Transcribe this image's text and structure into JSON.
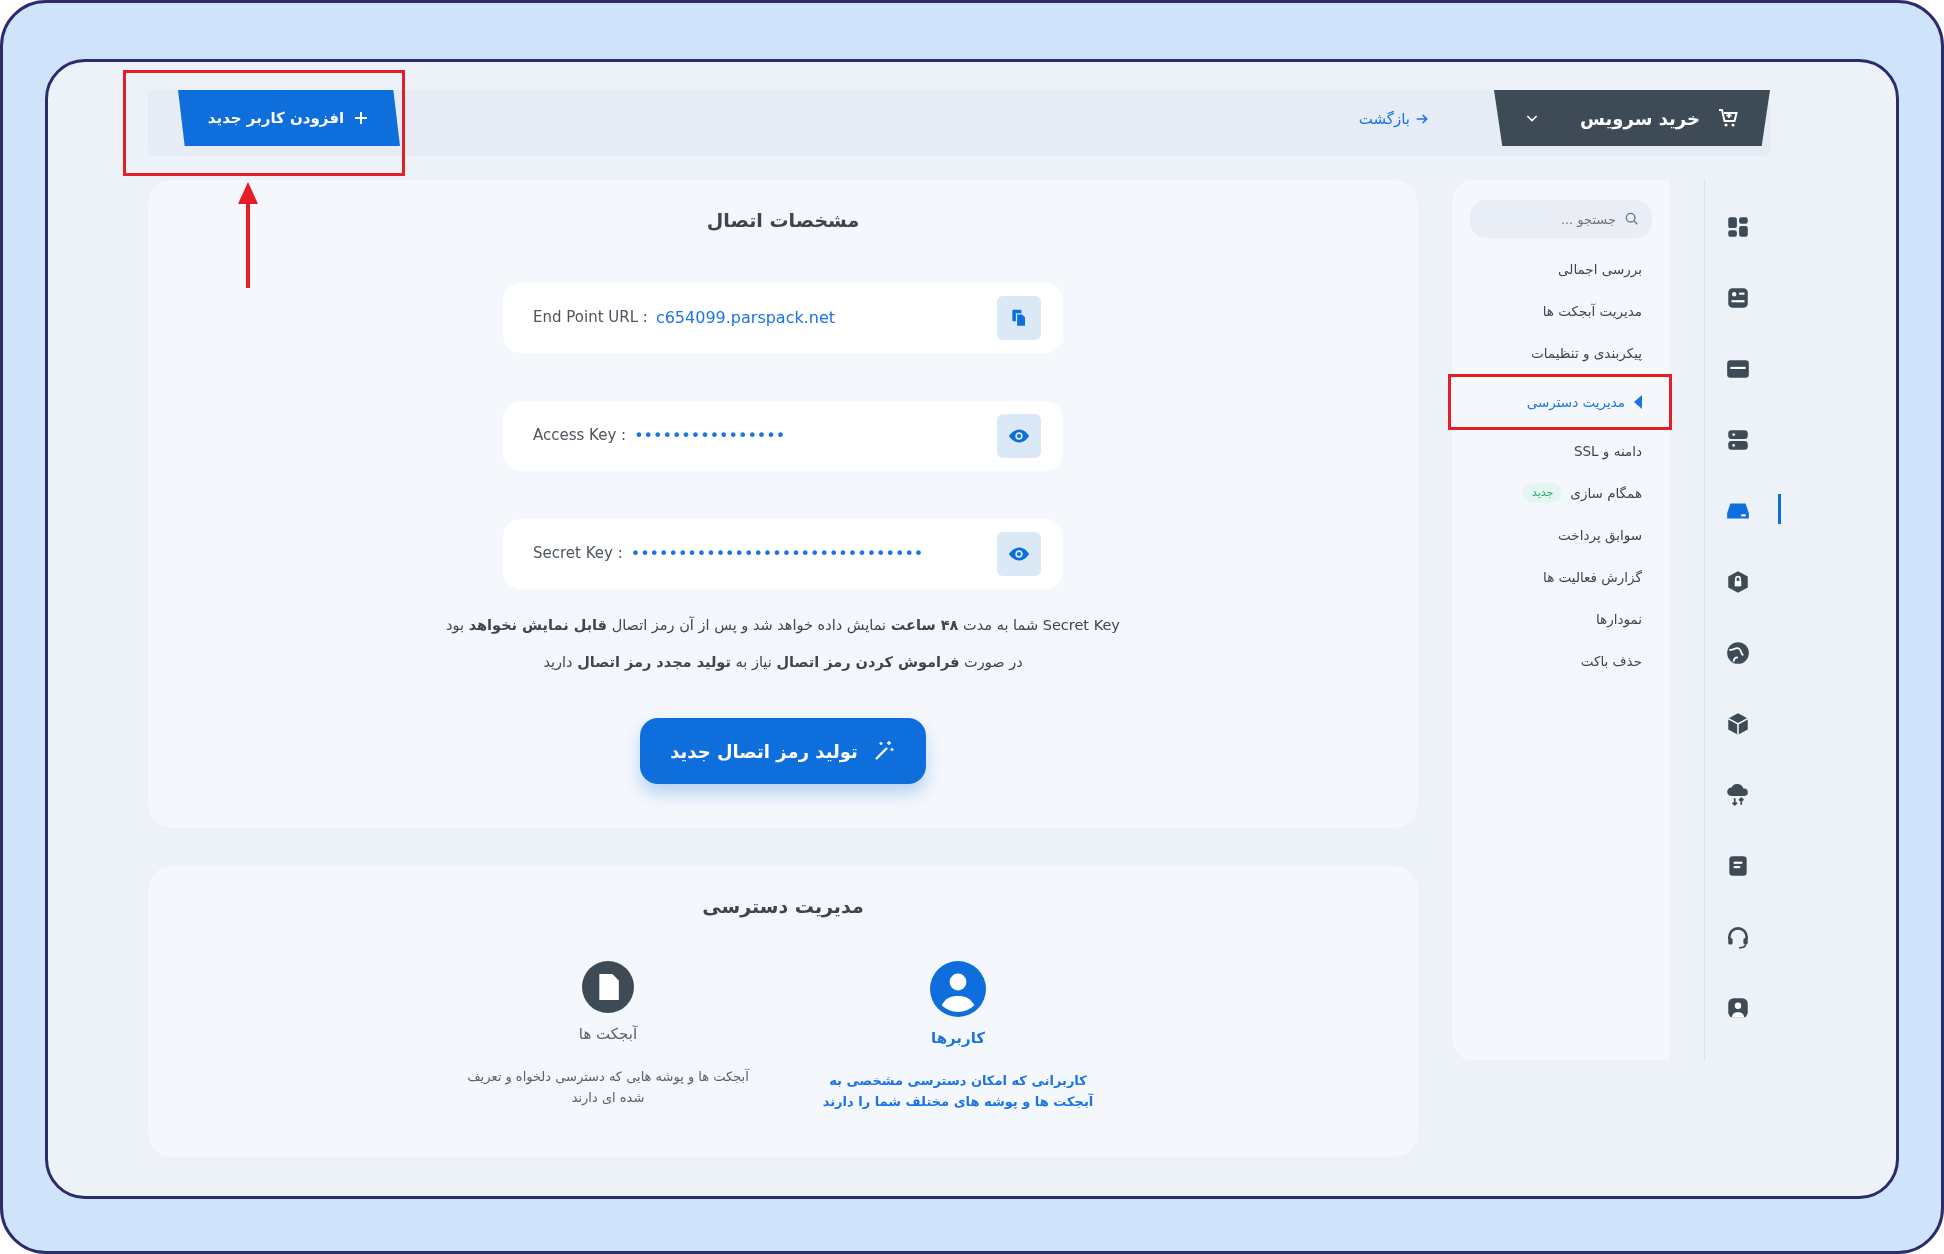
{
  "topbar": {
    "buy_button": {
      "label": "خرید سرویس"
    },
    "back_link": {
      "label": "بازگشت"
    },
    "add_user_button": {
      "label": "افزودن کاربر جدید",
      "highlighted": true
    }
  },
  "rail_icons": [
    {
      "selected": false
    },
    {
      "selected": false
    },
    {
      "selected": false
    },
    {
      "selected": false
    },
    {
      "selected": true
    },
    {
      "selected": false
    },
    {
      "selected": false
    },
    {
      "selected": false
    },
    {
      "selected": false
    },
    {
      "selected": false
    },
    {
      "selected": false
    },
    {
      "selected": false
    }
  ],
  "sidebar": {
    "search": {
      "placeholder": "جستجو ..."
    },
    "items": [
      {
        "label": "بررسی اجمالی",
        "selected": false,
        "highlighted": false
      },
      {
        "label": "مدیریت آبجکت ها",
        "selected": false,
        "highlighted": false
      },
      {
        "label": "پیکربندی و تنظیمات",
        "selected": false,
        "highlighted": false
      },
      {
        "label": "مدیریت دسترسی",
        "selected": true,
        "highlighted": true
      },
      {
        "label": "دامنه و SSL",
        "selected": false,
        "highlighted": false
      },
      {
        "label": "همگام سازی",
        "badge": "جدید",
        "selected": false,
        "highlighted": false
      },
      {
        "label": "سوابق پرداخت",
        "selected": false,
        "highlighted": false
      },
      {
        "label": "گزارش فعالیت ها",
        "selected": false,
        "highlighted": false
      },
      {
        "label": "نمودارها",
        "selected": false,
        "highlighted": false
      },
      {
        "label": "حذف باکت",
        "selected": false,
        "highlighted": false
      }
    ]
  },
  "connection": {
    "title": "مشخصات اتصال",
    "fields": [
      {
        "label": "End Point URL :",
        "value": "c654099.parspack.net",
        "kind": "copy"
      },
      {
        "label": "Access Key :",
        "value": "••••••••••••••••",
        "kind": "reveal"
      },
      {
        "label": "Secret Key :",
        "value": "•••••••••••••••••••••••••••••••",
        "kind": "reveal"
      }
    ],
    "notes": [
      "Secret Key شما به مدت **۴۸ ساعت** نمایش داده خواهد شد و پس از آن رمز اتصال **قابل نمایش نخواهد** بود",
      "در صورت **فراموش کردن رمز اتصال** نیاز به **تولید مجدد رمز اتصال** دارید"
    ],
    "generate_button": {
      "label": "تولید رمز اتصال جدید"
    }
  },
  "access": {
    "title": "مدیریت دسترسی",
    "options": [
      {
        "kind": "users",
        "title": "کاربرها",
        "description": "کاربرانی که امکان دسترسی مشخصی به آبجکت ها و پوشه های مختلف شما را دارند",
        "selected": true
      },
      {
        "kind": "objects",
        "title": "آبجکت ها",
        "description": "آبجکت ها و پوشه هایی که دسترسی دلخواه و تعریف شده ای دارند",
        "selected": false
      }
    ]
  }
}
